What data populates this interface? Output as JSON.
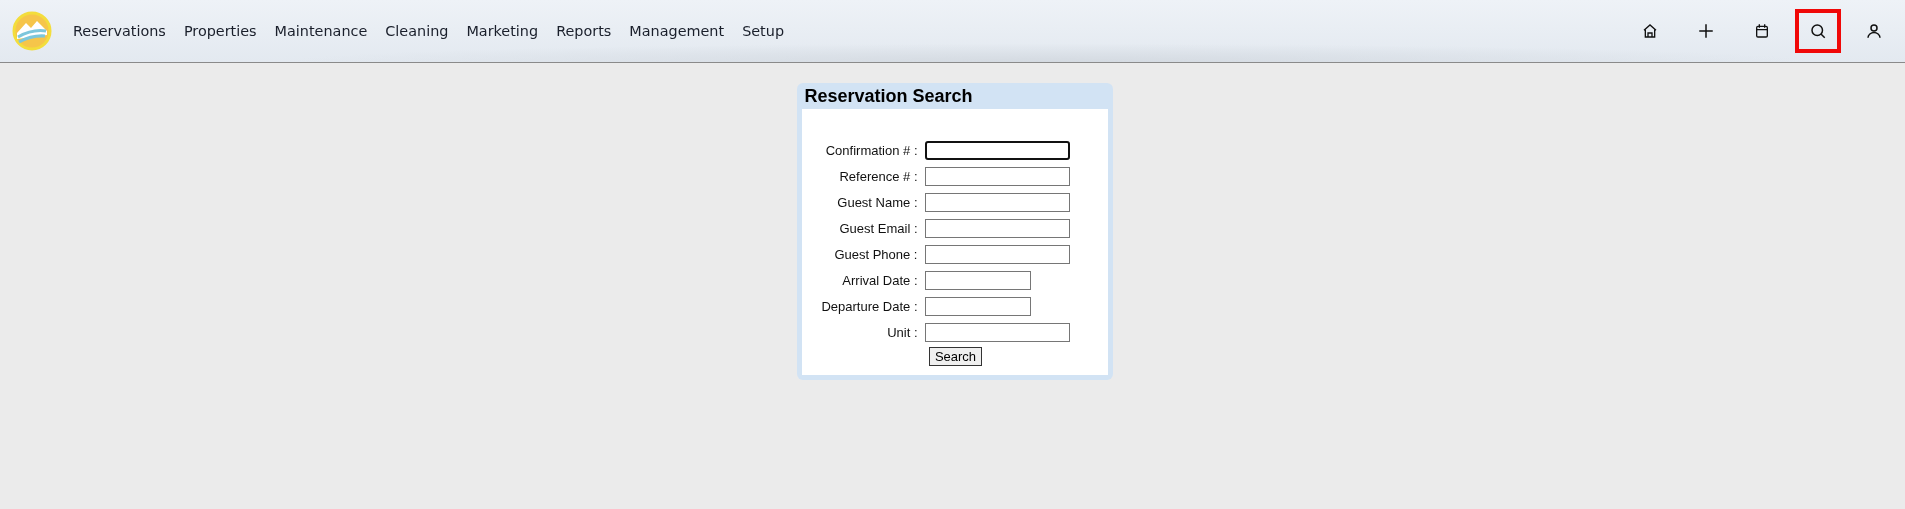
{
  "nav": {
    "items": [
      {
        "label": "Reservations"
      },
      {
        "label": "Properties"
      },
      {
        "label": "Maintenance"
      },
      {
        "label": "Cleaning"
      },
      {
        "label": "Marketing"
      },
      {
        "label": "Reports"
      },
      {
        "label": "Management"
      },
      {
        "label": "Setup"
      }
    ],
    "tools": [
      {
        "kind": "home",
        "selected": false
      },
      {
        "kind": "add",
        "selected": false
      },
      {
        "kind": "calendar",
        "selected": false
      },
      {
        "kind": "search",
        "selected": true
      },
      {
        "kind": "user",
        "selected": false
      }
    ]
  },
  "panel": {
    "title": "Reservation Search",
    "fields": [
      {
        "label": "Confirmation # :",
        "kind": "text",
        "focused": true
      },
      {
        "label": "Reference # :",
        "kind": "text",
        "focused": false
      },
      {
        "label": "Guest Name :",
        "kind": "text",
        "focused": false
      },
      {
        "label": "Guest Email :",
        "kind": "text",
        "focused": false
      },
      {
        "label": "Guest Phone :",
        "kind": "text",
        "focused": false
      },
      {
        "label": "Arrival Date :",
        "kind": "date",
        "focused": false
      },
      {
        "label": "Departure Date :",
        "kind": "date",
        "focused": false
      },
      {
        "label": "Unit :",
        "kind": "text",
        "focused": false
      }
    ],
    "button": "Search"
  }
}
